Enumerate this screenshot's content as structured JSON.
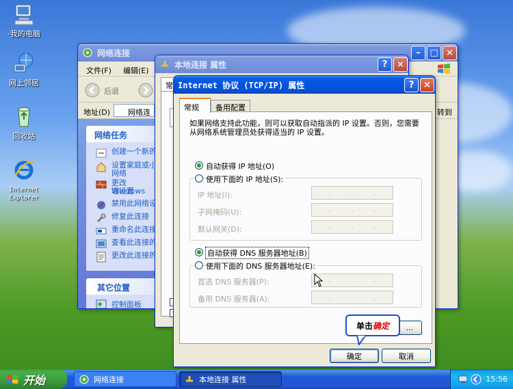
{
  "desktop": {
    "icons": [
      {
        "label": "-我的电脑"
      },
      {
        "label": "网上邻居"
      },
      {
        "label": "回收站"
      },
      {
        "label": "Internet Explorer"
      }
    ]
  },
  "network_window": {
    "title": "网络连接",
    "menu": {
      "file": "文件(F)",
      "edit": "编辑(E)"
    },
    "back_label": "后退",
    "address_label": "地址(D)",
    "address_value": "网络连接",
    "goto_label": "转到",
    "tasks_header": "网络任务",
    "tasks": [
      "创建一个新的",
      "设置家庭或小",
      "网络",
      "更改 Windows",
      "墙设置",
      "禁用此网络设",
      "修复此连接",
      "重命名此连接",
      "查看此连接的",
      "更改此连接的"
    ],
    "other_header": "其它位置",
    "other_items": [
      "控制面板"
    ]
  },
  "local_conn_window": {
    "title": "本地连接 属性",
    "tab_partial": "常"
  },
  "tcp_dialog": {
    "title": "Internet 协议 (TCP/IP) 属性",
    "tabs": [
      "常规",
      "备用配置"
    ],
    "description": "如果网络支持此功能，则可以获取自动指派的 IP 设置。否则，您需要从网络系统管理员处获得适当的 IP 设置。",
    "auto_ip": "自动获得 IP 地址(O)",
    "manual_ip": "使用下面的 IP 地址(S):",
    "ip_label": "IP 地址(I):",
    "mask_label": "子网掩码(U):",
    "gateway_label": "默认网关(D):",
    "auto_dns": "自动获得 DNS 服务器地址(B)",
    "manual_dns": "使用下面的 DNS 服务器地址(E):",
    "pref_dns": "首选 DNS 服务器(P):",
    "alt_dns": "备用 DNS 服务器(A):",
    "advanced_tail": "...",
    "ok": "确定",
    "cancel": "取消",
    "callout_prefix": "单击",
    "callout_em": "确定"
  },
  "taskbar": {
    "start": "开始",
    "tasks": [
      "网络连接",
      "本地连接 属性"
    ],
    "clock": "15:56"
  },
  "colors": {
    "title_active": "#0054e3",
    "dialog_bg": "#ece9d8",
    "callout_emphasis": "#d40000",
    "link_blue": "#215dc6"
  }
}
